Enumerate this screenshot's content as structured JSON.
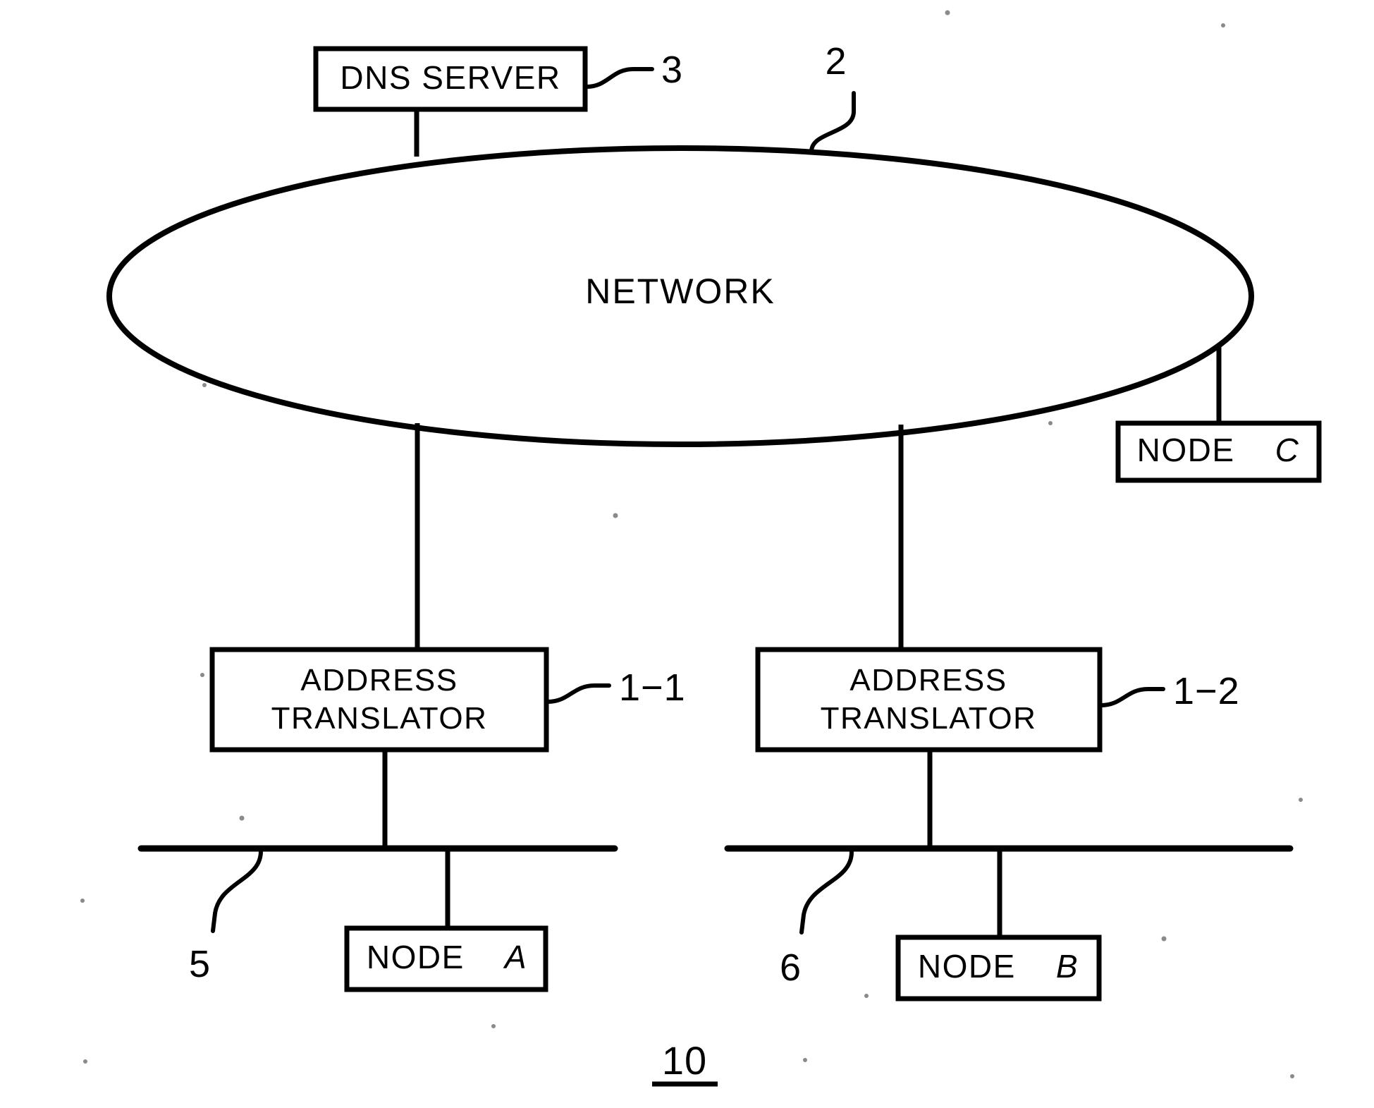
{
  "figure": {
    "number": "10",
    "title_text": "10"
  },
  "nodes": {
    "dns_server": {
      "label": "DNS  SERVER",
      "ref": "3"
    },
    "network": {
      "label": "NETWORK",
      "ref": "2"
    },
    "node_c": {
      "label_prefix": "NODE",
      "label_letter": "C"
    },
    "node_a": {
      "label_prefix": "NODE",
      "label_letter": "A"
    },
    "node_b": {
      "label_prefix": "NODE",
      "label_letter": "B"
    },
    "address_translator_1": {
      "label_line1": "ADDRESS",
      "label_line2": "TRANSLATOR",
      "ref": "1−1"
    },
    "address_translator_2": {
      "label_line1": "ADDRESS",
      "label_line2": "TRANSLATOR",
      "ref": "1−2"
    }
  },
  "buses": {
    "bus_left": {
      "ref": "5"
    },
    "bus_right": {
      "ref": "6"
    }
  },
  "colors": {
    "ink": "#000000",
    "paper": "#ffffff"
  }
}
